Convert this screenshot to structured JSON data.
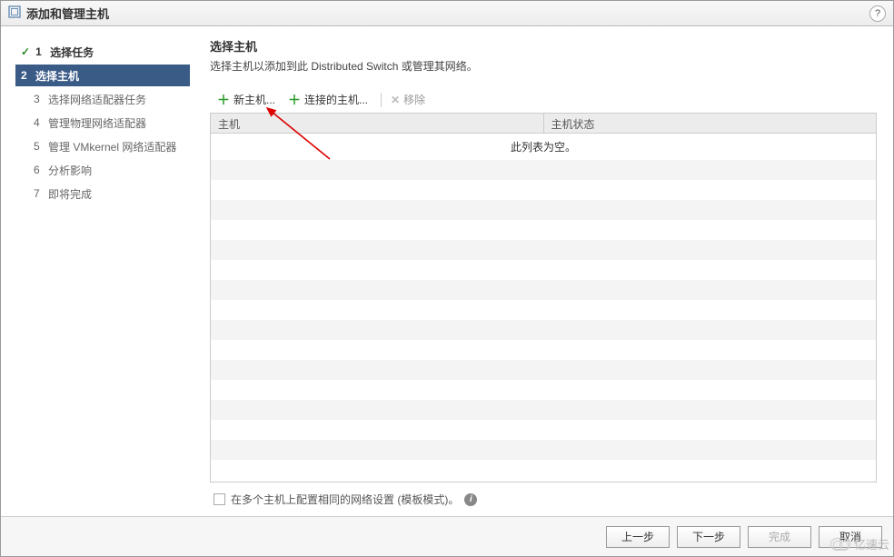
{
  "dialog": {
    "title": "添加和管理主机"
  },
  "sidebar": {
    "steps": [
      {
        "num": "1",
        "label": "选择任务",
        "state": "done"
      },
      {
        "num": "2",
        "label": "选择主机",
        "state": "active"
      },
      {
        "num": "3",
        "label": "选择网络适配器任务",
        "state": "todo"
      },
      {
        "num": "4",
        "label": "管理物理网络适配器",
        "state": "todo"
      },
      {
        "num": "5",
        "label": "管理 VMkernel 网络适配器",
        "state": "todo"
      },
      {
        "num": "6",
        "label": "分析影响",
        "state": "todo"
      },
      {
        "num": "7",
        "label": "即将完成",
        "state": "todo"
      }
    ]
  },
  "main": {
    "title": "选择主机",
    "desc": "选择主机以添加到此 Distributed Switch 或管理其网络。",
    "toolbar": {
      "new_host": "新主机...",
      "connected_host": "连接的主机...",
      "remove": "移除"
    },
    "table": {
      "col_host": "主机",
      "col_status": "主机状态",
      "empty": "此列表为空。"
    },
    "checkbox_label": "在多个主机上配置相同的网络设置 (模板模式)。"
  },
  "footer": {
    "back": "上一步",
    "next": "下一步",
    "finish": "完成",
    "cancel": "取消"
  },
  "watermark": "亿速云"
}
